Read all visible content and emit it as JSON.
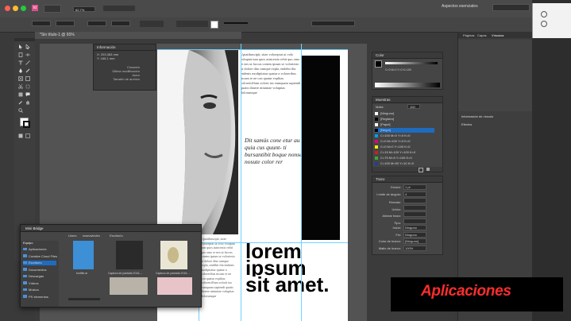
{
  "window": {
    "title_right": "Aspectos esenciales",
    "zoom": "62,7%",
    "colors": {
      "close": "#ff5f57",
      "min": "#febc2e",
      "max": "#28c840"
    }
  },
  "document_tab": {
    "label": "*Sin título-1 @ 65%"
  },
  "info_panel": {
    "title": "Información",
    "lines": [
      "Creación",
      "Última modificación",
      "Autor",
      "Tamaño de archivo"
    ],
    "coords": "X: 203,383 mm\nY: 165,1 mm"
  },
  "page": {
    "pullquote": "Dit samús cone etur au quia cus quunt- ti bursantibit boque nonse nosute color rer",
    "headline": [
      "lorem",
      "ipsum",
      "sit amet."
    ],
    "body_text": "Uptatibuscipit, sitae voloreprat ut volo voluptat ium quos asincestio rehit quo omo re nes ut laccus conem ipsum se voloriesto ut dolore dita cumque expla, endebit ilia endenis modipitatur quatur a voloreribus mcum re ne con quatur explitas voloreicillum volorit ius eumquam sapiendi quatis ditaere nimintae voluptias dolorumque"
  },
  "swatches_panel": {
    "title": "Muestras",
    "tint_label": "Matiz:",
    "tint_value": "100",
    "items": [
      {
        "name": "[Ninguno]",
        "color": "#ffffff"
      },
      {
        "name": "[Registro]",
        "color": "#000000"
      },
      {
        "name": "[Papel]",
        "color": "#ffffff"
      },
      {
        "name": "[Negro]",
        "color": "#000000"
      },
      {
        "name": "C=100 M=0 Y=0 K=0",
        "color": "#00a0e0"
      },
      {
        "name": "C=0 M=100 Y=0 K=0",
        "color": "#e4007c"
      },
      {
        "name": "C=0 M=0 Y=100 K=0",
        "color": "#ffec00"
      },
      {
        "name": "C=15 M=100 Y=100 K=0",
        "color": "#d01e24"
      },
      {
        "name": "C=75 M=5 Y=100 K=0",
        "color": "#3aa935"
      },
      {
        "name": "C=100 M=90 Y=10 K=0",
        "color": "#1f3f93"
      }
    ]
  },
  "color_panel": {
    "title": "Color",
    "values": "C=0 M=0 Y=0 K=100"
  },
  "stroke_panel": {
    "title": "Trazo",
    "fields": [
      {
        "label": "Grosor:",
        "value": "1 pt"
      },
      {
        "label": "Límite de ángulo:",
        "value": "4"
      },
      {
        "label": "Remate:",
        "value": ""
      },
      {
        "label": "Unión:",
        "value": ""
      },
      {
        "label": "Alinear trazo:",
        "value": ""
      },
      {
        "label": "Tipo:",
        "value": ""
      },
      {
        "label": "Inicio:",
        "value": "Ninguno"
      },
      {
        "label": "Fin:",
        "value": "Ninguno"
      },
      {
        "label": "Color de hueco:",
        "value": "[Ninguno]"
      },
      {
        "label": "Matiz de hueco:",
        "value": "100%"
      }
    ]
  },
  "far_right": {
    "tabs": [
      "Páginas",
      "Capas",
      "Vínculos"
    ],
    "section1": "Información de vínculo",
    "section2": "Efectos"
  },
  "mini_bridge": {
    "title": "Mini Bridge",
    "path": [
      "Users",
      "macvwindex",
      "Escritorio"
    ],
    "section_label": "Equipo",
    "folders": [
      "Aplicaciones",
      "Creative Cloud Files",
      "Escritorio",
      "Documentos",
      "Descargas",
      "Vídeos",
      "Música",
      "PS elementos"
    ],
    "thumbs": [
      {
        "caption": "fontfile.ai",
        "color": "#3d8fd6"
      },
      {
        "caption": "Captura de pantalla 2016-...",
        "color": "#2a2a2a"
      },
      {
        "caption": "Captura de pantalla 2016-...",
        "color": "#eae6d6"
      }
    ]
  },
  "banner": {
    "text": "Aplicaciones",
    "color": "#ff2d2d"
  }
}
